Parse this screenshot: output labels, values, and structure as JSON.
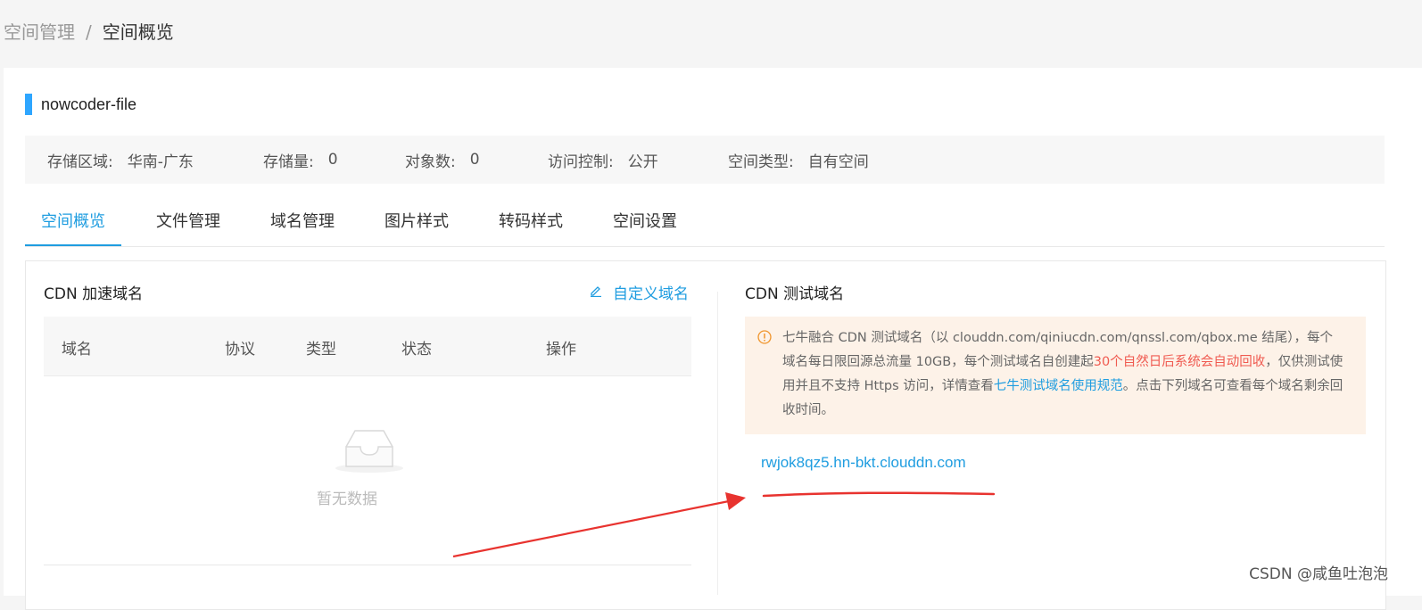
{
  "breadcrumb": {
    "parent": "空间管理",
    "separator": "/",
    "current": "空间概览"
  },
  "bucket": {
    "name": "nowcoder-file",
    "accent_color": "#2ea6ff"
  },
  "info": [
    {
      "label": "存储区域:",
      "value": "华南-广东"
    },
    {
      "label": "存储量:",
      "value": "0"
    },
    {
      "label": "对象数:",
      "value": "0"
    },
    {
      "label": "访问控制:",
      "value": "公开"
    },
    {
      "label": "空间类型:",
      "value": "自有空间"
    }
  ],
  "tabs": [
    {
      "label": "空间概览",
      "active": true
    },
    {
      "label": "文件管理",
      "active": false
    },
    {
      "label": "域名管理",
      "active": false
    },
    {
      "label": "图片样式",
      "active": false
    },
    {
      "label": "转码样式",
      "active": false
    },
    {
      "label": "空间设置",
      "active": false
    }
  ],
  "cdn_accel": {
    "title": "CDN 加速域名",
    "custom_link": "自定义域名",
    "columns": [
      "域名",
      "协议",
      "类型",
      "状态",
      "操作"
    ],
    "empty_text": "暂无数据"
  },
  "cdn_test": {
    "title": "CDN 测试域名",
    "notice": {
      "part1": "七牛融合 CDN 测试域名（以 clouddn.com/qiniucdn.com/qnssl.com/qbox.me 结尾），每个域名每日限回源总流量 10GB，每个测试域名自创建起",
      "red": "30个自然日后系统会自动回收",
      "part2": "，仅供测试使用并且不支持 Https 访问，详情查看",
      "link": "七牛测试域名使用规范",
      "part3": "。点击下列域名可查看每个域名剩余回收时间。"
    },
    "domain": "rwjok8qz5.hn-bkt.clouddn.com"
  },
  "watermark": "CSDN @咸鱼吐泡泡",
  "colors": {
    "primary": "#1f9de0",
    "danger": "#f05a50",
    "notice_bg": "#fdf2e8",
    "annotation": "#e8332f"
  }
}
